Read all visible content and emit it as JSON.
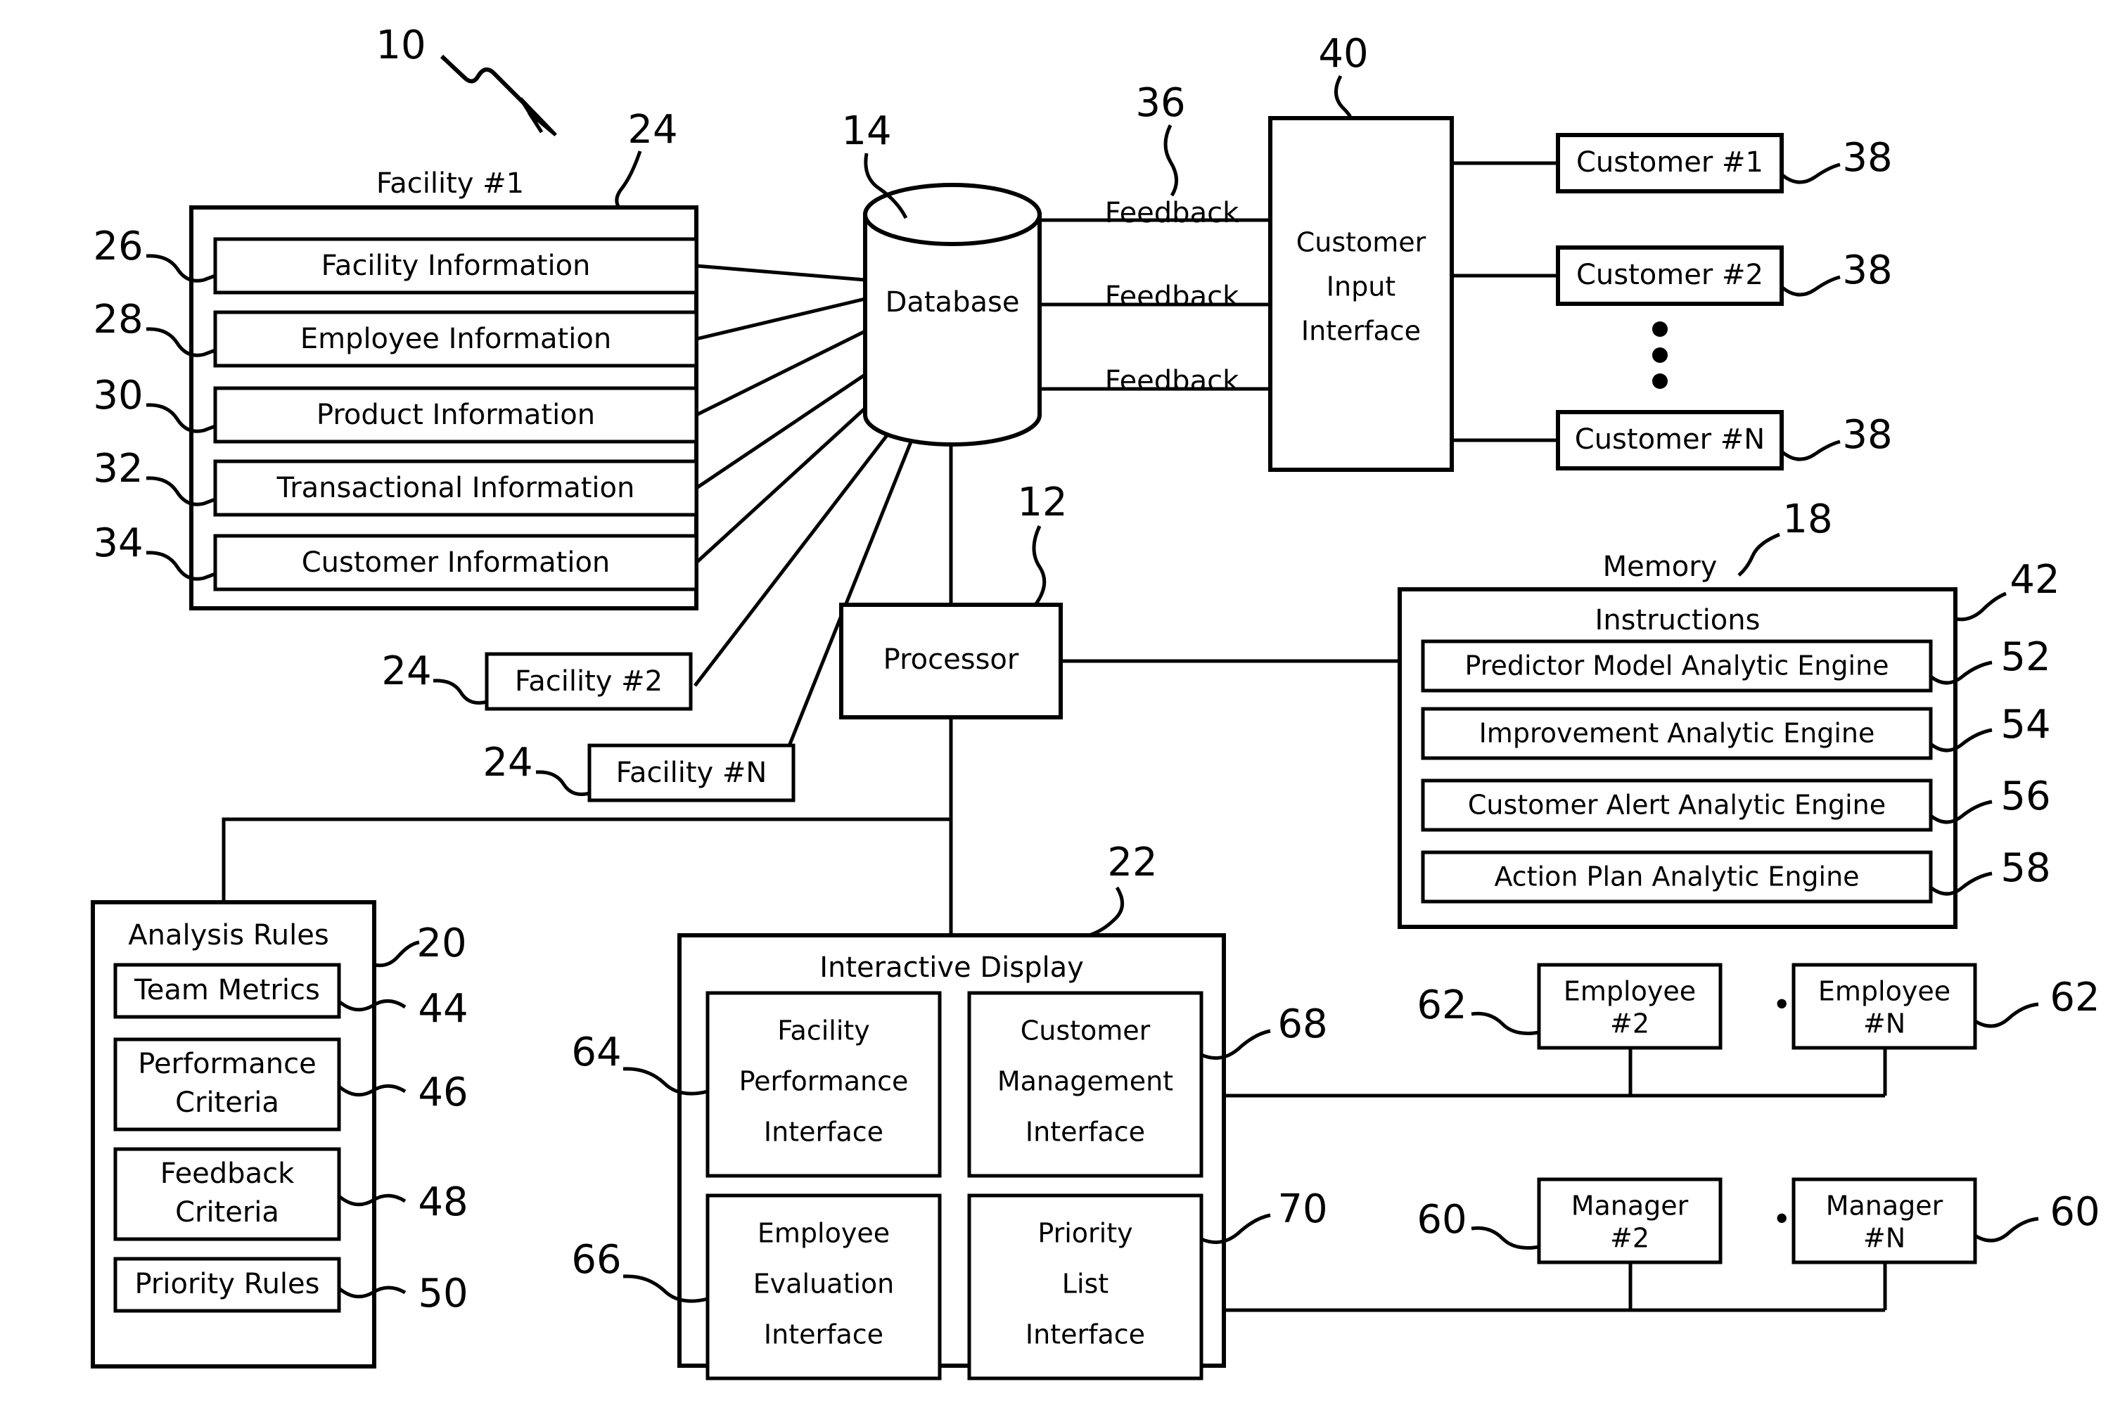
{
  "figure": {
    "system_ref": "10",
    "title_note": "Patent block diagram of facility performance management system"
  },
  "facility1": {
    "title": "Facility #1",
    "ref": "24",
    "items": [
      {
        "label": "Facility Information",
        "ref": "26"
      },
      {
        "label": "Employee Information",
        "ref": "28"
      },
      {
        "label": "Product Information",
        "ref": "30"
      },
      {
        "label": "Transactional Information",
        "ref": "32"
      },
      {
        "label": "Customer Information",
        "ref": "34"
      }
    ]
  },
  "other_facilities": [
    {
      "label": "Facility #2",
      "ref": "24"
    },
    {
      "label": "Facility #N",
      "ref": "24"
    }
  ],
  "database": {
    "label": "Database",
    "ref": "14"
  },
  "feedback": {
    "ref": "36",
    "labels": [
      "Feedback",
      "Feedback",
      "Feedback"
    ]
  },
  "customer_input_interface": {
    "line1": "Customer",
    "line2": "Input",
    "line3": "Interface",
    "ref": "40"
  },
  "customers": [
    {
      "label": "Customer #1",
      "ref": "38"
    },
    {
      "label": "Customer #2",
      "ref": "38"
    },
    {
      "label": "Customer #N",
      "ref": "38"
    }
  ],
  "customer_ellipsis": "vertical-dots",
  "processor": {
    "label": "Processor",
    "ref": "12"
  },
  "memory": {
    "caption": "Memory",
    "ref": "18",
    "instructions_title": "Instructions",
    "instructions_ref": "42",
    "engines": [
      {
        "label": "Predictor Model Analytic Engine",
        "ref": "52"
      },
      {
        "label": "Improvement Analytic Engine",
        "ref": "54"
      },
      {
        "label": "Customer Alert Analytic Engine",
        "ref": "56"
      },
      {
        "label": "Action Plan Analytic Engine",
        "ref": "58"
      }
    ]
  },
  "analysis_rules": {
    "title": "Analysis Rules",
    "ref": "20",
    "items": [
      {
        "label": "Team Metrics",
        "ref": "44",
        "lines": [
          "Team Metrics"
        ]
      },
      {
        "label": "Performance Criteria",
        "ref": "46",
        "lines": [
          "Performance",
          "Criteria"
        ]
      },
      {
        "label": "Feedback Criteria",
        "ref": "48",
        "lines": [
          "Feedback",
          "Criteria"
        ]
      },
      {
        "label": "Priority Rules",
        "ref": "50",
        "lines": [
          "Priority Rules"
        ]
      }
    ]
  },
  "interactive_display": {
    "title": "Interactive Display",
    "ref": "22",
    "panels": [
      {
        "lines": [
          "Facility",
          "Performance",
          "Interface"
        ],
        "ref": "64"
      },
      {
        "lines": [
          "Customer",
          "Management",
          "Interface"
        ],
        "ref": "68"
      },
      {
        "lines": [
          "Employee",
          "Evaluation",
          "Interface"
        ],
        "ref": "66"
      },
      {
        "lines": [
          "Priority",
          "List",
          "Interface"
        ],
        "ref": "70"
      }
    ]
  },
  "employees": {
    "ref_left": "62",
    "ref_right": "62",
    "ellipsis": "• • •",
    "boxes": [
      {
        "line1": "Employee",
        "line2": "#2"
      },
      {
        "line1": "Employee",
        "line2": "#N"
      }
    ]
  },
  "managers": {
    "ref_left": "60",
    "ref_right": "60",
    "ellipsis": "• • •",
    "boxes": [
      {
        "line1": "Manager",
        "line2": "#2"
      },
      {
        "line1": "Manager",
        "line2": "#N"
      }
    ]
  },
  "colors": {
    "ink": "#000000",
    "paper": "#ffffff"
  }
}
